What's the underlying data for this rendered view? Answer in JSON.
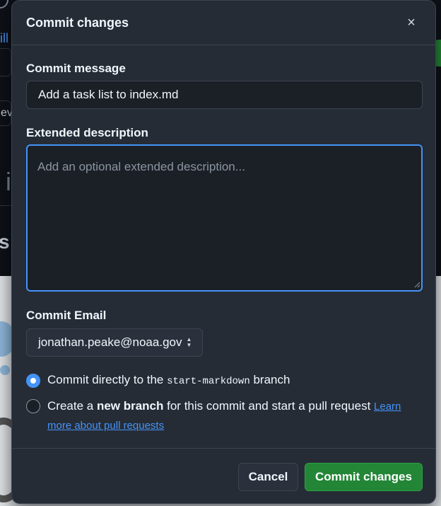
{
  "background": {
    "partial_link_text": "ill",
    "partial_button_text": "evi",
    "partial_big_text": "i",
    "partial_heading_text": "s"
  },
  "dialog": {
    "title": "Commit changes",
    "close_icon": "×",
    "commit_message": {
      "label": "Commit message",
      "value": "Add a task list to index.md"
    },
    "extended_description": {
      "label": "Extended description",
      "placeholder": "Add an optional extended description..."
    },
    "commit_email": {
      "label": "Commit Email",
      "selected": "jonathan.peake@noaa.gov"
    },
    "options": {
      "direct": {
        "prefix": "Commit directly to the ",
        "branch": "start-markdown",
        "suffix": " branch",
        "checked": true
      },
      "new_branch": {
        "prefix": "Create a ",
        "bold": "new branch",
        "suffix": " for this commit and start a pull request ",
        "link": "Learn more about pull requests",
        "checked": false
      }
    },
    "buttons": {
      "cancel": "Cancel",
      "commit": "Commit changes"
    }
  },
  "colors": {
    "accent": "#4493f8",
    "primary_button": "#238636",
    "dialog_bg": "#262c36"
  }
}
